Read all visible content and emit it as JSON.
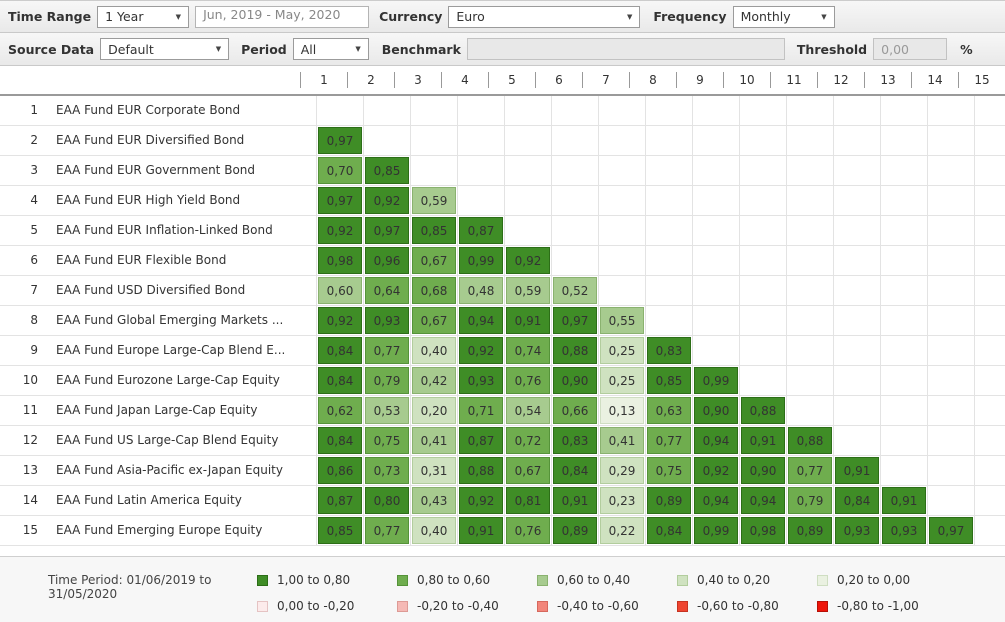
{
  "toolbar": {
    "time_range_label": "Time Range",
    "time_range_value": "1 Year",
    "date_range_value": "Jun, 2019 - May, 2020",
    "currency_label": "Currency",
    "currency_value": "Euro",
    "frequency_label": "Frequency",
    "frequency_value": "Monthly",
    "source_data_label": "Source Data",
    "source_data_value": "Default",
    "period_label": "Period",
    "period_value": "All",
    "benchmark_label": "Benchmark",
    "benchmark_value": "",
    "threshold_label": "Threshold",
    "threshold_value": "0,00",
    "threshold_unit": "%",
    "dropdown_caret_icon": "▼"
  },
  "palette": {
    "g5": {
      "fill": "#3f8d26",
      "border": "#2c6e17"
    },
    "g4": {
      "fill": "#6fad4e",
      "border": "#559339"
    },
    "g3": {
      "fill": "#a7cb8f",
      "border": "#8ab26f"
    },
    "g2": {
      "fill": "#cfe2c0",
      "border": "#b2cd9d"
    },
    "g1": {
      "fill": "#eaf1e1",
      "border": "#cfdec2"
    },
    "r1": {
      "fill": "#fcebeb",
      "border": "#e5c3c3"
    },
    "r2": {
      "fill": "#f5b9b5",
      "border": "#dd9a95"
    },
    "r3": {
      "fill": "#f2857a",
      "border": "#d6685d"
    },
    "r4": {
      "fill": "#ef4530",
      "border": "#c63321"
    },
    "r5": {
      "fill": "#ee1409",
      "border": "#b60f06"
    }
  },
  "matrix": {
    "columns": [
      "1",
      "2",
      "3",
      "4",
      "5",
      "6",
      "7",
      "8",
      "9",
      "10",
      "11",
      "12",
      "13",
      "14",
      "15"
    ],
    "rows": [
      {
        "num": "1",
        "name": "EAA Fund EUR Corporate Bond",
        "values": []
      },
      {
        "num": "2",
        "name": "EAA Fund EUR Diversified Bond",
        "values": [
          "0,97"
        ]
      },
      {
        "num": "3",
        "name": "EAA Fund EUR Government Bond",
        "values": [
          "0,70",
          "0,85"
        ]
      },
      {
        "num": "4",
        "name": "EAA Fund EUR High Yield Bond",
        "values": [
          "0,97",
          "0,92",
          "0,59"
        ]
      },
      {
        "num": "5",
        "name": "EAA Fund EUR Inflation-Linked Bond",
        "values": [
          "0,92",
          "0,97",
          "0,85",
          "0,87"
        ]
      },
      {
        "num": "6",
        "name": "EAA Fund EUR Flexible Bond",
        "values": [
          "0,98",
          "0,96",
          "0,67",
          "0,99",
          "0,92"
        ]
      },
      {
        "num": "7",
        "name": "EAA Fund USD Diversified Bond",
        "values": [
          "0,60",
          "0,64",
          "0,68",
          "0,48",
          "0,59",
          "0,52"
        ]
      },
      {
        "num": "8",
        "name": "EAA Fund Global Emerging Markets ...",
        "values": [
          "0,92",
          "0,93",
          "0,67",
          "0,94",
          "0,91",
          "0,97",
          "0,55"
        ]
      },
      {
        "num": "9",
        "name": "EAA Fund Europe Large-Cap Blend E...",
        "values": [
          "0,84",
          "0,77",
          "0,40",
          "0,92",
          "0,74",
          "0,88",
          "0,25",
          "0,83"
        ]
      },
      {
        "num": "10",
        "name": "EAA Fund Eurozone Large-Cap Equity",
        "values": [
          "0,84",
          "0,79",
          "0,42",
          "0,93",
          "0,76",
          "0,90",
          "0,25",
          "0,85",
          "0,99"
        ]
      },
      {
        "num": "11",
        "name": "EAA Fund Japan Large-Cap Equity",
        "values": [
          "0,62",
          "0,53",
          "0,20",
          "0,71",
          "0,54",
          "0,66",
          "0,13",
          "0,63",
          "0,90",
          "0,88"
        ]
      },
      {
        "num": "12",
        "name": "EAA Fund US Large-Cap Blend Equity",
        "values": [
          "0,84",
          "0,75",
          "0,41",
          "0,87",
          "0,72",
          "0,83",
          "0,41",
          "0,77",
          "0,94",
          "0,91",
          "0,88"
        ]
      },
      {
        "num": "13",
        "name": "EAA Fund Asia-Pacific ex-Japan Equity",
        "values": [
          "0,86",
          "0,73",
          "0,31",
          "0,88",
          "0,67",
          "0,84",
          "0,29",
          "0,75",
          "0,92",
          "0,90",
          "0,77",
          "0,91"
        ]
      },
      {
        "num": "14",
        "name": "EAA Fund Latin America Equity",
        "values": [
          "0,87",
          "0,80",
          "0,43",
          "0,92",
          "0,81",
          "0,91",
          "0,23",
          "0,89",
          "0,94",
          "0,94",
          "0,79",
          "0,84",
          "0,91"
        ]
      },
      {
        "num": "15",
        "name": "EAA Fund Emerging Europe Equity",
        "values": [
          "0,85",
          "0,77",
          "0,40",
          "0,91",
          "0,76",
          "0,89",
          "0,22",
          "0,84",
          "0,99",
          "0,98",
          "0,89",
          "0,93",
          "0,93",
          "0,97"
        ]
      }
    ]
  },
  "footer": {
    "time_period": "Time Period: 01/06/2019 to 31/05/2020",
    "legend": [
      {
        "label": "1,00 to 0,80",
        "palette": "g5"
      },
      {
        "label": "0,80 to 0,60",
        "palette": "g4"
      },
      {
        "label": "0,60 to 0,40",
        "palette": "g3"
      },
      {
        "label": "0,40 to 0,20",
        "palette": "g2"
      },
      {
        "label": "0,20 to 0,00",
        "palette": "g1"
      },
      {
        "label": "0,00 to -0,20",
        "palette": "r1"
      },
      {
        "label": "-0,20 to -0,40",
        "palette": "r2"
      },
      {
        "label": "-0,40 to -0,60",
        "palette": "r3"
      },
      {
        "label": "-0,60 to -0,80",
        "palette": "r4"
      },
      {
        "label": "-0,80 to -1,00",
        "palette": "r5"
      }
    ]
  }
}
